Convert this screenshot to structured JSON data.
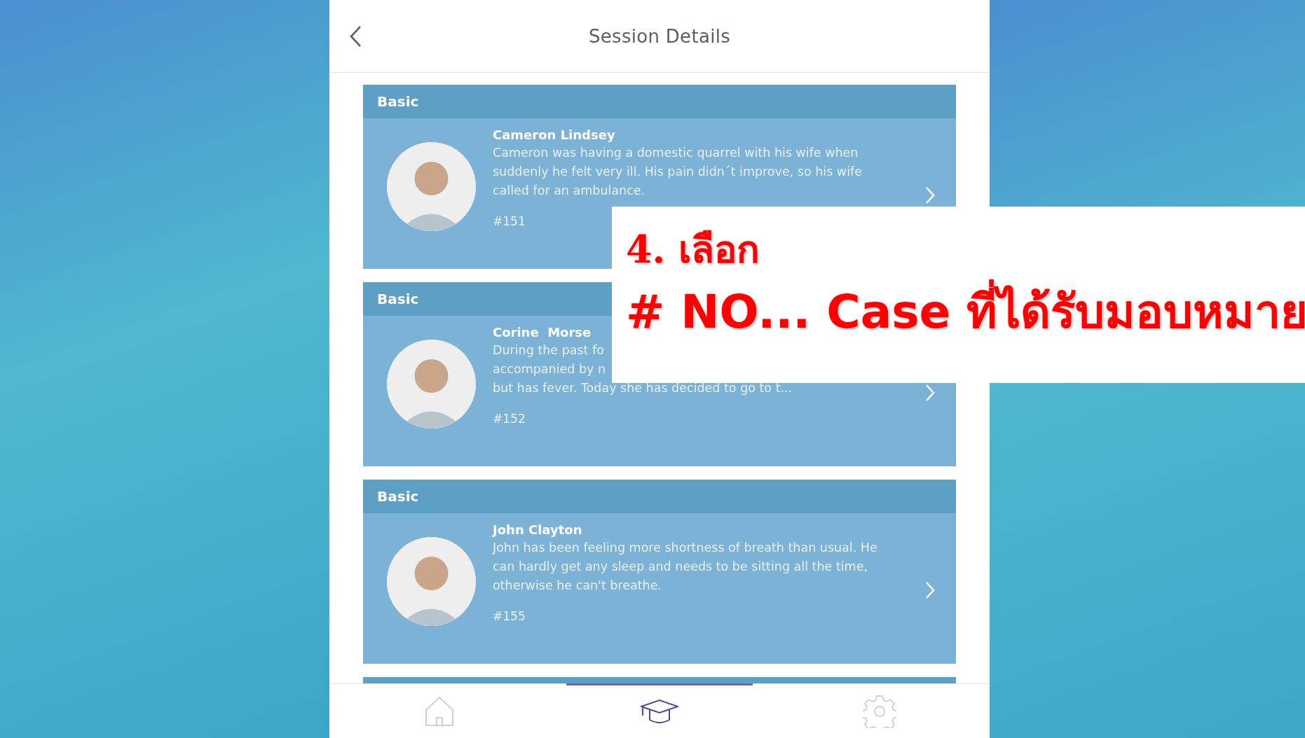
{
  "header": {
    "title": "Session Details"
  },
  "cases": [
    {
      "level": "Basic",
      "name": "Cameron Lindsey",
      "lines": [
        "Cameron was having a domestic quarrel with his wife when",
        "suddenly he felt very ill. His pain didn´t improve, so his wife",
        "called for an ambulance."
      ],
      "number": "#151"
    },
    {
      "level": "Basic",
      "name": "Corine  Morse",
      "lines": [
        "During the past fo",
        "accompanied by n",
        "but has fever. Today she has decided to go to t..."
      ],
      "number": "#152"
    },
    {
      "level": "Basic",
      "name": "John Clayton",
      "lines": [
        "John has been feeling more shortness of breath than usual. He",
        "can hardly get any sleep and needs to be sitting all the time,",
        "otherwise he can't breathe."
      ],
      "number": "#155"
    }
  ],
  "nav": [
    {
      "kind": "home",
      "selected": false
    },
    {
      "kind": "courses",
      "selected": true
    },
    {
      "kind": "settings",
      "selected": false
    }
  ],
  "callout": {
    "step": "4. เลือก",
    "instruction": "# NO... Case ที่ได้รับมอบหมาย"
  }
}
